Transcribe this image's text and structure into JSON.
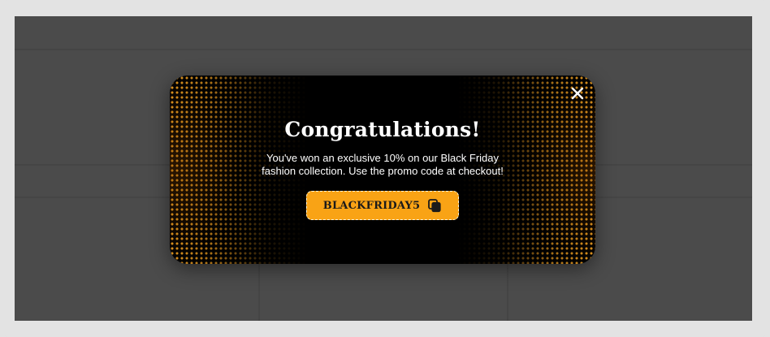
{
  "modal": {
    "title": "Congratulations!",
    "message_line1": "You've won an exclusive 10% on our Black Friday",
    "message_line2": "fashion collection. Use the promo code at checkout!",
    "promo_code": "BLACKFRIDAY5",
    "close_icon": "close-icon",
    "copy_icon": "copy-icon"
  },
  "colors": {
    "overlay": "#4b4b4b",
    "modal_bg": "#000000",
    "accent": "#f9a315",
    "dots": "#e0951f"
  }
}
